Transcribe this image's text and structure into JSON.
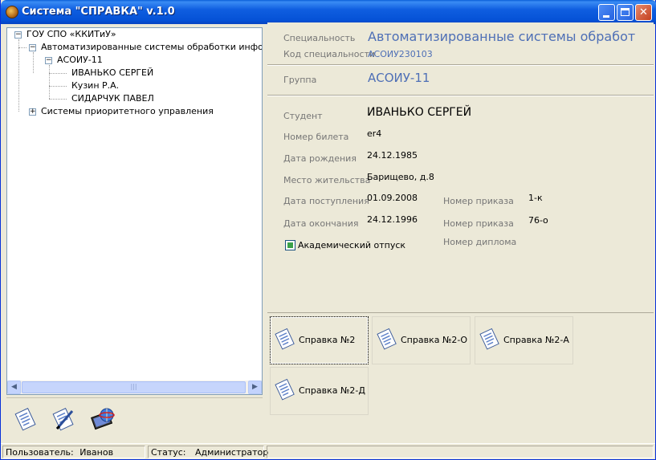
{
  "window": {
    "title": "Система \"СПРАВКА\" v.1.0",
    "buttons": {
      "minimize": "_",
      "maximize": "□",
      "close": "✕"
    }
  },
  "tree": {
    "root": "ГОУ СПО «ККИТиУ»",
    "specialties": [
      {
        "label": "Автоматизированные системы обработки информации",
        "expander": "−"
      },
      {
        "label": "Системы приоритетного управления",
        "expander": "+"
      }
    ],
    "group": {
      "label": "АСОИУ-11",
      "expander": "−"
    },
    "students": [
      "ИВАНЬКО СЕРГЕЙ",
      "Кузин Р.А.",
      "СИДАРЧУК ПАВЕЛ"
    ],
    "root_expander": "−"
  },
  "scrollbar": {
    "left": "◀",
    "right": "▶",
    "grip": "|||"
  },
  "toolbar": {
    "icons": [
      "document-icon",
      "edit-document-icon",
      "computer-globe-icon"
    ]
  },
  "info": {
    "specialty_label": "Специальность",
    "specialty_value": "Автоматизированные системы обработ",
    "code_label": "Код специальности",
    "code_value": "АСОИУ230103",
    "group_label": "Группа",
    "group_value": "АСОИУ-11",
    "student_label": "Студент",
    "student_value": "ИВАНЬКО СЕРГЕЙ",
    "ticket_label": "Номер билета",
    "ticket_value": "er4",
    "birth_label": "Дата рождения",
    "birth_value": "24.12.1985",
    "residence_label": "Место жительства",
    "residence_value": "Барищево, д.8",
    "admission_label": "Дата поступления",
    "admission_value": "01.09.2008",
    "order1_label": "Номер приказа",
    "order1_value": "1-к",
    "graduation_label": "Дата окончания",
    "graduation_value": "24.12.1996",
    "order2_label": "Номер приказа",
    "order2_value": "76-о",
    "diploma_label": "Номер диплома",
    "academic_leave_label": "Академический отпуск",
    "academic_leave_checked": true
  },
  "buttons": [
    {
      "label": "Справка №2",
      "focused": true
    },
    {
      "label": "Справка №2-О",
      "focused": false
    },
    {
      "label": "Справка №2-А",
      "focused": false
    },
    {
      "label": "Справка №2-Д",
      "focused": false
    }
  ],
  "status": {
    "user_label": "Пользователь:",
    "user_value": "Иванов",
    "status_label": "Статус:",
    "status_value": "Администратор"
  },
  "colors": {
    "accent_blue": "#4e6fb6",
    "titlebar": "#0551d6",
    "checkbox_mark": "#3ba14a"
  }
}
